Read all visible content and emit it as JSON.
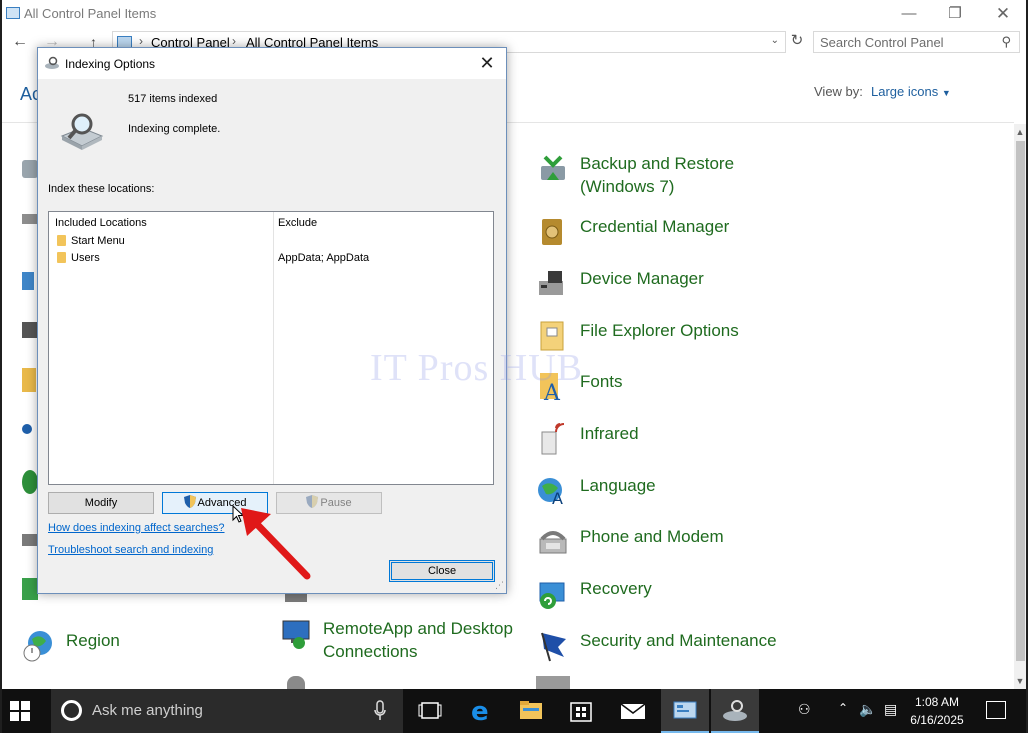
{
  "window": {
    "title": "All Control Panel Items",
    "breadcrumb": [
      "Control Panel",
      "All Control Panel Items"
    ],
    "search_placeholder": "Search Control Panel",
    "heading_partial": "Ac",
    "view_by_label": "View by:",
    "view_by_value": "Large icons"
  },
  "items_right": [
    {
      "label_line1": "Backup and Restore",
      "label_line2": "(Windows 7)"
    },
    {
      "label_line1": "Credential Manager"
    },
    {
      "label_line1": "Device Manager"
    },
    {
      "label_line1": "File Explorer Options"
    },
    {
      "label_line1": "Fonts"
    },
    {
      "label_line1": "Infrared"
    },
    {
      "label_line1": "Language"
    },
    {
      "label_line1": "Phone and Modem"
    },
    {
      "label_line1": "Recovery"
    },
    {
      "label_line1": "Security and Maintenance"
    }
  ],
  "items_bottom": [
    {
      "label": "Region"
    },
    {
      "label_line1": "RemoteApp and Desktop",
      "label_line2": "Connections"
    }
  ],
  "dialog": {
    "title": "Indexing Options",
    "items_indexed": "517 items indexed",
    "status": "Indexing complete.",
    "locations_label": "Index these locations:",
    "columns": [
      "Included Locations",
      "Exclude"
    ],
    "rows": [
      {
        "location": "Start Menu",
        "exclude": ""
      },
      {
        "location": "Users",
        "exclude": "AppData; AppData"
      }
    ],
    "buttons": {
      "modify": "Modify",
      "advanced": "Advanced",
      "pause": "Pause",
      "close": "Close"
    },
    "links": {
      "help": "How does indexing affect searches?",
      "troubleshoot": "Troubleshoot search and indexing"
    }
  },
  "watermark": "IT Pros HUB",
  "taskbar": {
    "search_placeholder": "Ask me anything",
    "time": "1:08 AM",
    "date": "6/16/2025"
  },
  "colors": {
    "link_green": "#1f6b1f",
    "link_blue": "#0066cc",
    "accent": "#0078d7",
    "taskbar": "#101010"
  }
}
